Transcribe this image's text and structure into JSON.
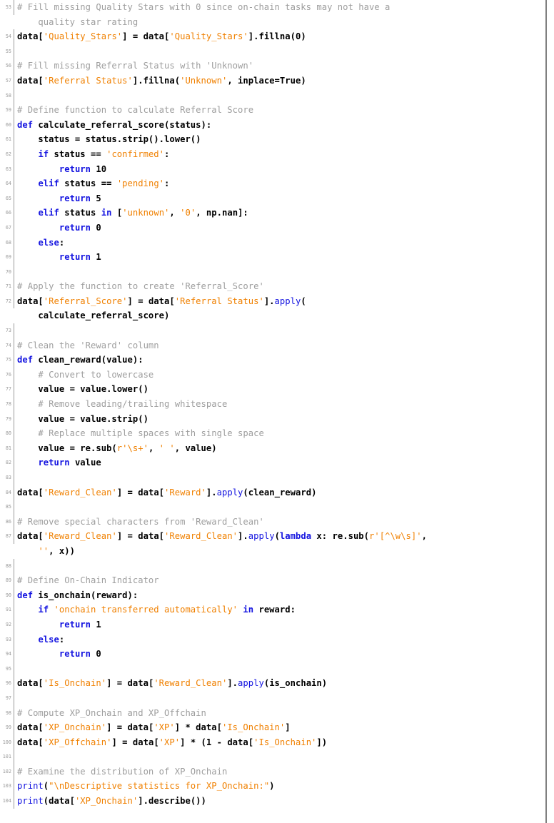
{
  "listing": {
    "language": "Python",
    "first_line_number": 53,
    "last_line_number": 104,
    "colors": {
      "background": "#ffffff",
      "text": "#000000",
      "comment": "#9e9e9e",
      "string": "#f08000",
      "keyword": "#1414e0",
      "function": "#1414e0",
      "gutter_number": "#9a9a9a",
      "gutter_rule": "#9c9c9c",
      "frame_rule": "#808080"
    },
    "lines": [
      {
        "num": "53",
        "tokens": [
          {
            "t": "# Fill missing Quality Stars with 0 since on-chain tasks may not have a",
            "c": "comment"
          }
        ]
      },
      {
        "num": "",
        "tokens": [
          {
            "t": "    quality star rating",
            "c": "comment"
          }
        ]
      },
      {
        "num": "54",
        "tokens": [
          {
            "t": "data[",
            "c": "plain"
          },
          {
            "t": "'Quality_Stars'",
            "c": "string"
          },
          {
            "t": "] = data[",
            "c": "plain"
          },
          {
            "t": "'Quality_Stars'",
            "c": "string"
          },
          {
            "t": "].fillna(0)",
            "c": "plain"
          }
        ]
      },
      {
        "num": "55",
        "tokens": []
      },
      {
        "num": "56",
        "tokens": [
          {
            "t": "# Fill missing Referral Status with 'Unknown'",
            "c": "comment"
          }
        ]
      },
      {
        "num": "57",
        "tokens": [
          {
            "t": "data[",
            "c": "plain"
          },
          {
            "t": "'Referral Status'",
            "c": "string"
          },
          {
            "t": "].fillna(",
            "c": "plain"
          },
          {
            "t": "'Unknown'",
            "c": "string"
          },
          {
            "t": ", inplace=True)",
            "c": "plain"
          }
        ]
      },
      {
        "num": "58",
        "tokens": []
      },
      {
        "num": "59",
        "tokens": [
          {
            "t": "# Define function to calculate Referral Score",
            "c": "comment"
          }
        ]
      },
      {
        "num": "60",
        "tokens": [
          {
            "t": "def",
            "c": "kw"
          },
          {
            "t": " calculate_referral_score(status):",
            "c": "plain"
          }
        ]
      },
      {
        "num": "61",
        "tokens": [
          {
            "t": "    status = status.strip().lower()",
            "c": "plain"
          }
        ]
      },
      {
        "num": "62",
        "tokens": [
          {
            "t": "    ",
            "c": "plain"
          },
          {
            "t": "if",
            "c": "kw"
          },
          {
            "t": " status == ",
            "c": "plain"
          },
          {
            "t": "'confirmed'",
            "c": "string"
          },
          {
            "t": ":",
            "c": "plain"
          }
        ]
      },
      {
        "num": "63",
        "tokens": [
          {
            "t": "        ",
            "c": "plain"
          },
          {
            "t": "return",
            "c": "kw"
          },
          {
            "t": " 10",
            "c": "plain"
          }
        ]
      },
      {
        "num": "64",
        "tokens": [
          {
            "t": "    ",
            "c": "plain"
          },
          {
            "t": "elif",
            "c": "kw"
          },
          {
            "t": " status == ",
            "c": "plain"
          },
          {
            "t": "'pending'",
            "c": "string"
          },
          {
            "t": ":",
            "c": "plain"
          }
        ]
      },
      {
        "num": "65",
        "tokens": [
          {
            "t": "        ",
            "c": "plain"
          },
          {
            "t": "return",
            "c": "kw"
          },
          {
            "t": " 5",
            "c": "plain"
          }
        ]
      },
      {
        "num": "66",
        "tokens": [
          {
            "t": "    ",
            "c": "plain"
          },
          {
            "t": "elif",
            "c": "kw"
          },
          {
            "t": " status ",
            "c": "plain"
          },
          {
            "t": "in",
            "c": "kw"
          },
          {
            "t": " [",
            "c": "plain"
          },
          {
            "t": "'unknown'",
            "c": "string"
          },
          {
            "t": ", ",
            "c": "plain"
          },
          {
            "t": "'0'",
            "c": "string"
          },
          {
            "t": ", np.nan]:",
            "c": "plain"
          }
        ]
      },
      {
        "num": "67",
        "tokens": [
          {
            "t": "        ",
            "c": "plain"
          },
          {
            "t": "return",
            "c": "kw"
          },
          {
            "t": " 0",
            "c": "plain"
          }
        ]
      },
      {
        "num": "68",
        "tokens": [
          {
            "t": "    ",
            "c": "plain"
          },
          {
            "t": "else",
            "c": "kw"
          },
          {
            "t": ":",
            "c": "plain"
          }
        ]
      },
      {
        "num": "69",
        "tokens": [
          {
            "t": "        ",
            "c": "plain"
          },
          {
            "t": "return",
            "c": "kw"
          },
          {
            "t": " 1",
            "c": "plain"
          }
        ]
      },
      {
        "num": "70",
        "tokens": []
      },
      {
        "num": "71",
        "tokens": [
          {
            "t": "# Apply the function to create 'Referral_Score'",
            "c": "comment"
          }
        ]
      },
      {
        "num": "72",
        "tokens": [
          {
            "t": "data[",
            "c": "plain"
          },
          {
            "t": "'Referral_Score'",
            "c": "string"
          },
          {
            "t": "] = data[",
            "c": "plain"
          },
          {
            "t": "'Referral Status'",
            "c": "string"
          },
          {
            "t": "].",
            "c": "plain"
          },
          {
            "t": "apply",
            "c": "fn"
          },
          {
            "t": "(",
            "c": "plain"
          }
        ]
      },
      {
        "num": "",
        "tokens": [
          {
            "t": "    calculate_referral_score)",
            "c": "plain"
          }
        ]
      },
      {
        "num": "73",
        "tokens": []
      },
      {
        "num": "74",
        "tokens": [
          {
            "t": "# Clean the 'Reward' column",
            "c": "comment"
          }
        ]
      },
      {
        "num": "75",
        "tokens": [
          {
            "t": "def",
            "c": "kw"
          },
          {
            "t": " clean_reward(value):",
            "c": "plain"
          }
        ]
      },
      {
        "num": "76",
        "tokens": [
          {
            "t": "    # Convert to lowercase",
            "c": "comment"
          }
        ]
      },
      {
        "num": "77",
        "tokens": [
          {
            "t": "    value = value.lower()",
            "c": "plain"
          }
        ]
      },
      {
        "num": "78",
        "tokens": [
          {
            "t": "    # Remove leading/trailing whitespace",
            "c": "comment"
          }
        ]
      },
      {
        "num": "79",
        "tokens": [
          {
            "t": "    value = value.strip()",
            "c": "plain"
          }
        ]
      },
      {
        "num": "80",
        "tokens": [
          {
            "t": "    # Replace multiple spaces with single space",
            "c": "comment"
          }
        ]
      },
      {
        "num": "81",
        "tokens": [
          {
            "t": "    value = re.sub(",
            "c": "plain"
          },
          {
            "t": "r'\\s+'",
            "c": "string"
          },
          {
            "t": ", ",
            "c": "plain"
          },
          {
            "t": "' '",
            "c": "string"
          },
          {
            "t": ", value)",
            "c": "plain"
          }
        ]
      },
      {
        "num": "82",
        "tokens": [
          {
            "t": "    ",
            "c": "plain"
          },
          {
            "t": "return",
            "c": "kw"
          },
          {
            "t": " value",
            "c": "plain"
          }
        ]
      },
      {
        "num": "83",
        "tokens": []
      },
      {
        "num": "84",
        "tokens": [
          {
            "t": "data[",
            "c": "plain"
          },
          {
            "t": "'Reward_Clean'",
            "c": "string"
          },
          {
            "t": "] = data[",
            "c": "plain"
          },
          {
            "t": "'Reward'",
            "c": "string"
          },
          {
            "t": "].",
            "c": "plain"
          },
          {
            "t": "apply",
            "c": "fn"
          },
          {
            "t": "(clean_reward)",
            "c": "plain"
          }
        ]
      },
      {
        "num": "85",
        "tokens": []
      },
      {
        "num": "86",
        "tokens": [
          {
            "t": "# Remove special characters from 'Reward_Clean'",
            "c": "comment"
          }
        ]
      },
      {
        "num": "87",
        "tokens": [
          {
            "t": "data[",
            "c": "plain"
          },
          {
            "t": "'Reward_Clean'",
            "c": "string"
          },
          {
            "t": "] = data[",
            "c": "plain"
          },
          {
            "t": "'Reward_Clean'",
            "c": "string"
          },
          {
            "t": "].",
            "c": "plain"
          },
          {
            "t": "apply",
            "c": "fn"
          },
          {
            "t": "(",
            "c": "plain"
          },
          {
            "t": "lambda",
            "c": "kw"
          },
          {
            "t": " x: re.sub(",
            "c": "plain"
          },
          {
            "t": "r'[^\\w\\s]'",
            "c": "string"
          },
          {
            "t": ",",
            "c": "plain"
          }
        ]
      },
      {
        "num": "",
        "tokens": [
          {
            "t": "    ",
            "c": "plain"
          },
          {
            "t": "''",
            "c": "string"
          },
          {
            "t": ", x))",
            "c": "plain"
          }
        ]
      },
      {
        "num": "88",
        "tokens": []
      },
      {
        "num": "89",
        "tokens": [
          {
            "t": "# Define On-Chain Indicator",
            "c": "comment"
          }
        ]
      },
      {
        "num": "90",
        "tokens": [
          {
            "t": "def",
            "c": "kw"
          },
          {
            "t": " is_onchain(reward):",
            "c": "plain"
          }
        ]
      },
      {
        "num": "91",
        "tokens": [
          {
            "t": "    ",
            "c": "plain"
          },
          {
            "t": "if",
            "c": "kw"
          },
          {
            "t": " ",
            "c": "plain"
          },
          {
            "t": "'onchain transferred automatically'",
            "c": "string"
          },
          {
            "t": " ",
            "c": "plain"
          },
          {
            "t": "in",
            "c": "kw"
          },
          {
            "t": " reward:",
            "c": "plain"
          }
        ]
      },
      {
        "num": "92",
        "tokens": [
          {
            "t": "        ",
            "c": "plain"
          },
          {
            "t": "return",
            "c": "kw"
          },
          {
            "t": " 1",
            "c": "plain"
          }
        ]
      },
      {
        "num": "93",
        "tokens": [
          {
            "t": "    ",
            "c": "plain"
          },
          {
            "t": "else",
            "c": "kw"
          },
          {
            "t": ":",
            "c": "plain"
          }
        ]
      },
      {
        "num": "94",
        "tokens": [
          {
            "t": "        ",
            "c": "plain"
          },
          {
            "t": "return",
            "c": "kw"
          },
          {
            "t": " 0",
            "c": "plain"
          }
        ]
      },
      {
        "num": "95",
        "tokens": []
      },
      {
        "num": "96",
        "tokens": [
          {
            "t": "data[",
            "c": "plain"
          },
          {
            "t": "'Is_Onchain'",
            "c": "string"
          },
          {
            "t": "] = data[",
            "c": "plain"
          },
          {
            "t": "'Reward_Clean'",
            "c": "string"
          },
          {
            "t": "].",
            "c": "plain"
          },
          {
            "t": "apply",
            "c": "fn"
          },
          {
            "t": "(is_onchain)",
            "c": "plain"
          }
        ]
      },
      {
        "num": "97",
        "tokens": []
      },
      {
        "num": "98",
        "tokens": [
          {
            "t": "# Compute XP_Onchain and XP_Offchain",
            "c": "comment"
          }
        ]
      },
      {
        "num": "99",
        "tokens": [
          {
            "t": "data[",
            "c": "plain"
          },
          {
            "t": "'XP_Onchain'",
            "c": "string"
          },
          {
            "t": "] = data[",
            "c": "plain"
          },
          {
            "t": "'XP'",
            "c": "string"
          },
          {
            "t": "] * data[",
            "c": "plain"
          },
          {
            "t": "'Is_Onchain'",
            "c": "string"
          },
          {
            "t": "]",
            "c": "plain"
          }
        ]
      },
      {
        "num": "100",
        "tokens": [
          {
            "t": "data[",
            "c": "plain"
          },
          {
            "t": "'XP_Offchain'",
            "c": "string"
          },
          {
            "t": "] = data[",
            "c": "plain"
          },
          {
            "t": "'XP'",
            "c": "string"
          },
          {
            "t": "] * (1 - data[",
            "c": "plain"
          },
          {
            "t": "'Is_Onchain'",
            "c": "string"
          },
          {
            "t": "])",
            "c": "plain"
          }
        ]
      },
      {
        "num": "101",
        "tokens": []
      },
      {
        "num": "102",
        "tokens": [
          {
            "t": "# Examine the distribution of XP_Onchain",
            "c": "comment"
          }
        ]
      },
      {
        "num": "103",
        "tokens": [
          {
            "t": "print",
            "c": "fn"
          },
          {
            "t": "(",
            "c": "plain"
          },
          {
            "t": "\"\\nDescriptive statistics for XP_Onchain:\"",
            "c": "string"
          },
          {
            "t": ")",
            "c": "plain"
          }
        ]
      },
      {
        "num": "104",
        "tokens": [
          {
            "t": "print",
            "c": "fn"
          },
          {
            "t": "(data[",
            "c": "plain"
          },
          {
            "t": "'XP_Onchain'",
            "c": "string"
          },
          {
            "t": "].describe())",
            "c": "plain"
          }
        ]
      }
    ]
  }
}
